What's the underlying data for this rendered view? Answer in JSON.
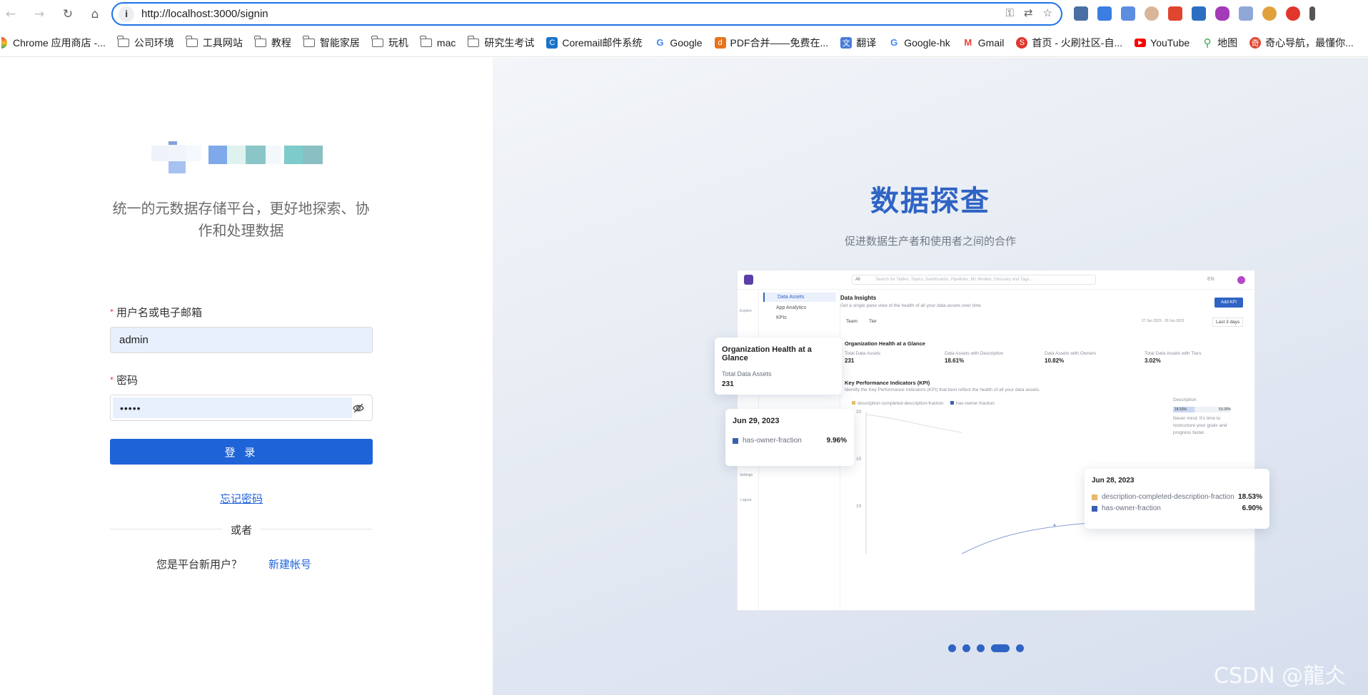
{
  "browser": {
    "url": "http://localhost:3000/signin",
    "bookmarks": [
      {
        "label": "Chrome 应用商店 -...",
        "icon": "chrome-icon"
      },
      {
        "label": "公司环境",
        "icon": "folder-icon"
      },
      {
        "label": "工具网站",
        "icon": "folder-icon"
      },
      {
        "label": "教程",
        "icon": "folder-icon"
      },
      {
        "label": "智能家居",
        "icon": "folder-icon"
      },
      {
        "label": "玩机",
        "icon": "folder-icon"
      },
      {
        "label": "mac",
        "icon": "folder-icon"
      },
      {
        "label": "研究生考试",
        "icon": "folder-icon"
      },
      {
        "label": "Coremail邮件系统",
        "icon": "coremail-icon"
      },
      {
        "label": "Google",
        "icon": "google-icon"
      },
      {
        "label": "PDF合并——免费在...",
        "icon": "pdf-icon"
      },
      {
        "label": "翻译",
        "icon": "translate-icon"
      },
      {
        "label": "Google-hk",
        "icon": "google-icon"
      },
      {
        "label": "Gmail",
        "icon": "gmail-icon"
      },
      {
        "label": "首页 - 火刷社区-自...",
        "icon": "huoshua-icon"
      },
      {
        "label": "YouTube",
        "icon": "youtube-icon"
      },
      {
        "label": "地图",
        "icon": "maps-icon"
      },
      {
        "label": "奇心导航，最懂你...",
        "icon": "qixin-icon"
      }
    ]
  },
  "login": {
    "tagline": "统一的元数据存储平台，更好地探索、协作和处理数据",
    "username_label": "用户名或电子邮箱",
    "username_value": "admin",
    "password_label": "密码",
    "password_value": "•••••",
    "login_button": "登 录",
    "forgot_password": "忘记密码",
    "or_text": "或者",
    "new_user_text": "您是平台新用户？",
    "signup_link": "新建帐号"
  },
  "carousel": {
    "title": "数据探查",
    "subtitle": "促进数据生产者和使用者之间的合作",
    "active_index": 3,
    "dot_count": 5,
    "preview": {
      "search_scope": "All",
      "search_placeholder": "Search for Tables, Topics, Dashboards, Pipelines, ML Models, Glossary and Tags...",
      "lang": "EN",
      "nav": [
        "Explore",
        "Settings",
        "Logout"
      ],
      "nav_items": [
        "Data Assets",
        "App Analytics",
        "KPIs"
      ],
      "page_title": "Data Insights",
      "page_desc": "Get a single pane view of the health of all your data assets over time",
      "add_kpi": "Add KPI",
      "filters": [
        "Team",
        "Tier"
      ],
      "date_range": "27 Jun 2023 - 30 Jun 2023",
      "period": "Last 3 days",
      "health_title": "Organization Health at a Glance",
      "metrics": [
        {
          "label": "Total Data Assets",
          "value": "231"
        },
        {
          "label": "Data Assets with Description",
          "value": "18.61%"
        },
        {
          "label": "Data Assets with Owners",
          "value": "10.82%"
        },
        {
          "label": "Total Data Assets with Tiers",
          "value": "3.02%"
        }
      ],
      "kpi_title": "Key Performance Indicators (KPI)",
      "kpi_desc": "Identify the Key Performance Indicators (KPI) that best reflect the health of all your data assets.",
      "legend": [
        "description-completed-description-fraction",
        "has-owner-fraction"
      ],
      "y_ticks": [
        "20",
        "15",
        "10"
      ],
      "side_title": "Description",
      "side_values": [
        "18.53%",
        "53.00%"
      ],
      "side_note": "Never mind. It's time to restructure your goals and progress faster."
    },
    "card_org": {
      "title": "Organization Health at a Glance",
      "label": "Total Data Assets",
      "value": "231"
    },
    "card_jun29": {
      "date": "Jun 29, 2023",
      "series": "has-owner-fraction",
      "value": "9.96%"
    },
    "card_jun28": {
      "date": "Jun 28, 2023",
      "rows": [
        {
          "series": "description-completed-description-fraction",
          "value": "18.53%"
        },
        {
          "series": "has-owner-fraction",
          "value": "6.90%"
        }
      ]
    }
  },
  "watermark": "CSDN @龍仌",
  "colors": {
    "primary": "#1f63d8",
    "title_blue": "#2f63c4",
    "series_owner": "#3a5fb0",
    "series_desc": "#e6b96b"
  }
}
